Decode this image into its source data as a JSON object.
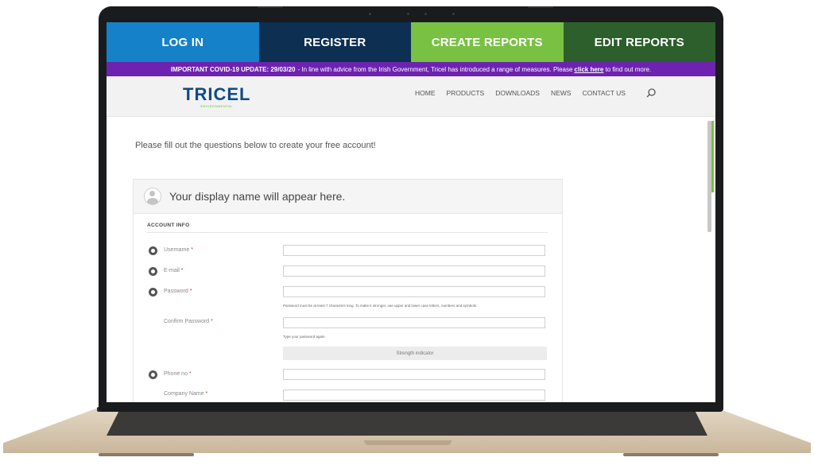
{
  "topnav": [
    {
      "label": "LOG IN",
      "cls": "nav-login"
    },
    {
      "label": "REGISTER",
      "cls": "nav-register"
    },
    {
      "label": "CREATE REPORTS",
      "cls": "nav-create"
    },
    {
      "label": "EDIT REPORTS",
      "cls": "nav-edit"
    }
  ],
  "banner": {
    "lead": "IMPORTANT COVID-19 UPDATE: 29/03/20",
    "text": " - In line with advice from the Irish Government, Tricel has introduced a range of measures. Please",
    "link": "click here",
    "tail": "to find out more."
  },
  "header": {
    "logo": "TRICEL",
    "logo_sub": "ENVIRONMENTAL",
    "menu": [
      "HOME",
      "PRODUCTS",
      "DOWNLOADS",
      "NEWS",
      "CONTACT US"
    ]
  },
  "intro": "Please fill out the questions below to create your free account!",
  "form": {
    "display_name": "Your display name will appear here.",
    "section": "ACCOUNT INFO",
    "username_label": "Username",
    "email_label": "E-mail",
    "password_label": "Password",
    "password_hint": "Password must be at least 7 characters long. To make it stronger, use upper and lower case letters, numbers and symbols.",
    "confirm_label": "Confirm Password",
    "confirm_hint": "Type your password again.",
    "strength": "Strength indicator",
    "phone_label": "Phone no",
    "company_label": "Company Name",
    "required_mark": "*"
  },
  "colors": {
    "login": "#1581c8",
    "register": "#0c2f52",
    "create": "#79c143",
    "edit": "#2c5f2b",
    "banner": "#6d23b0",
    "logo": "#0e4a8a"
  }
}
